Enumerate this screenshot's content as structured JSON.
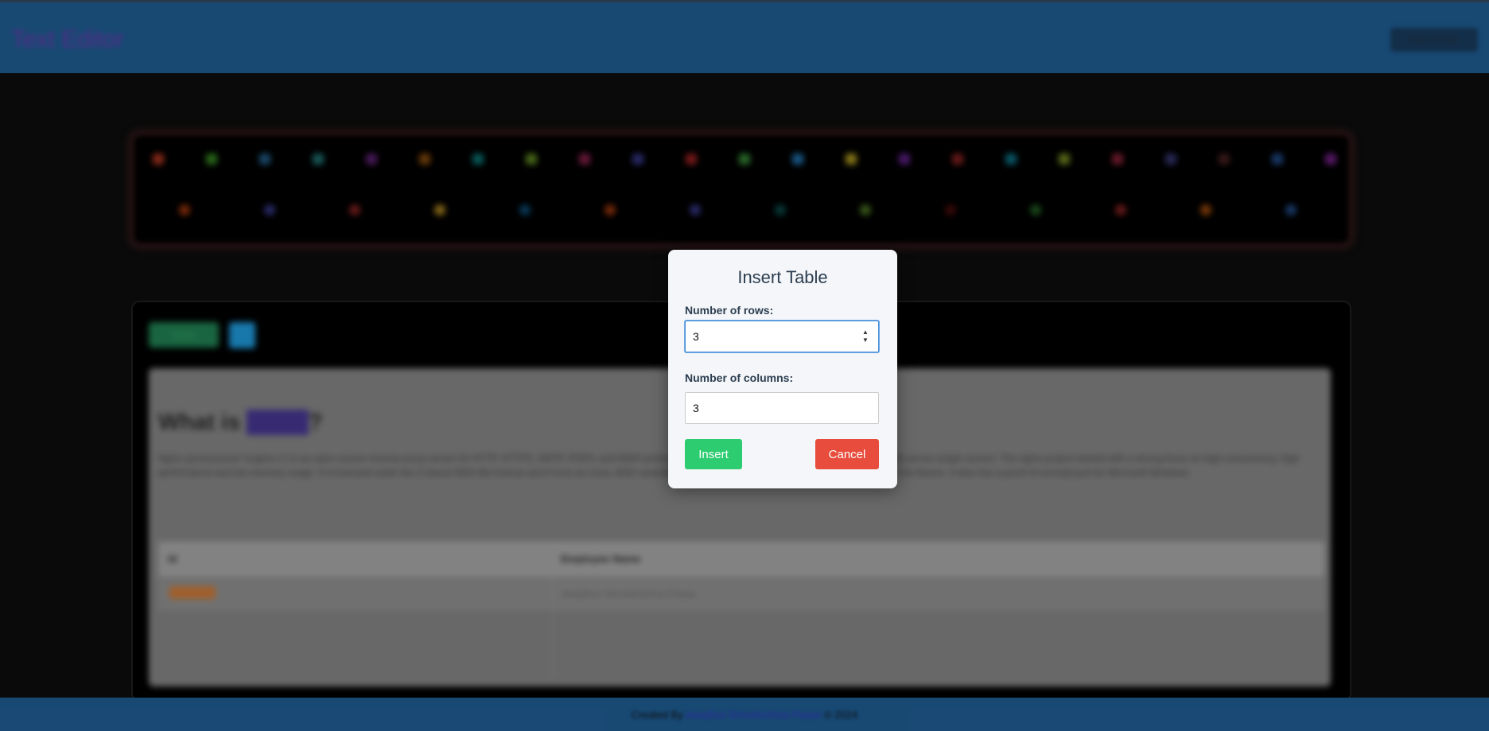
{
  "header": {
    "app_title": "Text Editor",
    "dark_mode_label": "Dark Mode"
  },
  "toolbar": {
    "row1_colors": [
      "#8a2a1a",
      "#2a6a1a",
      "#1a4a6a",
      "#1a5a5a",
      "#4a1a5a",
      "#6a3a0a",
      "#0a5a5a",
      "#4a6a1a",
      "#6a1a3a",
      "#2a2a6a",
      "#7a1a1a",
      "#2a6a2a",
      "#1a5a8a",
      "#8a7a1a",
      "#4a1a6a",
      "#6a1a1a",
      "#0a5a6a",
      "#5a6a1a",
      "#6a1a2a",
      "#2a2a5a",
      "#3a1a1a",
      "#1a3a6a",
      "#5a1a6a"
    ],
    "row2_colors": [
      "#7a2a0a",
      "#2a2a6a",
      "#6a1a1a",
      "#8a6a1a",
      "#0a3a5a",
      "#7a2a0a",
      "#2a2a6a",
      "#0a3a3a",
      "#3a5a1a",
      "#3a0a0a",
      "#1a4a1a",
      "#6a1a1a",
      "#7a3a0a",
      "#1a3a6a"
    ]
  },
  "editor": {
    "save_label": "Save",
    "heading_prefix": "What is ",
    "heading_highlight": "nginx",
    "heading_suffix": "?",
    "paragraph": "Nginx (pronounced \"engine-x\") is an open source reverse proxy server for HTTP, HTTPS, SMTP, POP3, and IMAP protocols, as well as a load balancer, HTTP cache, and a web server (origin server). The nginx project started with a strong focus on high concurrency, high performance and low memory usage. It is licensed under the 2-clause BSD-like license and it runs on Linux, BSD variants, Mac OS X, Solaris, AIX, HP-UX, as well as on other *nix flavors. It also has a proof of concept port for Microsoft Windows.",
    "table_headers": [
      "Id",
      "Employee Name"
    ],
    "table_rows": [
      [
        "",
        "Awadhut Shreekrishna Pawar"
      ]
    ]
  },
  "footer": {
    "prefix": "Created By",
    "author": "Awadhut Shreekrishna Pawar",
    "suffix": "© 2024"
  },
  "modal": {
    "title": "Insert Table",
    "rows_label": "Number of rows:",
    "rows_value": "3",
    "cols_label": "Number of columns:",
    "cols_value": "3",
    "insert_label": "Insert",
    "cancel_label": "Cancel"
  },
  "colors": {
    "insert": "#2ecc71",
    "cancel": "#e74c3c",
    "header_bg": "#1a4d7a"
  }
}
